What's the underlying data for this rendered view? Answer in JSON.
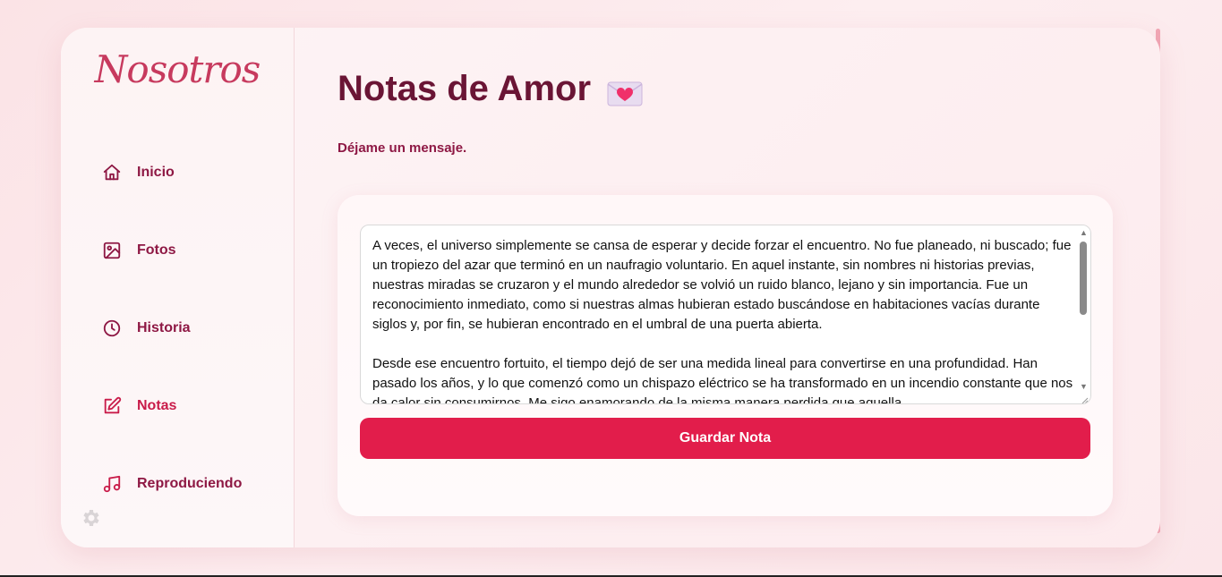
{
  "sidebar": {
    "logo": "Nosotros",
    "items": [
      {
        "label": "Inicio",
        "icon": "home-icon"
      },
      {
        "label": "Fotos",
        "icon": "image-icon"
      },
      {
        "label": "Historia",
        "icon": "clock-icon"
      },
      {
        "label": "Notas",
        "icon": "edit-icon",
        "active": true
      },
      {
        "label": "Reproduciendo",
        "icon": "music-icon"
      }
    ],
    "settings_icon": "gear-icon"
  },
  "main": {
    "title": "Notas de Amor",
    "title_emoji": "love-letter-icon",
    "subtitle": "Déjame un mensaje.",
    "note": {
      "value": "A veces, el universo simplemente se cansa de esperar y decide forzar el encuentro. No fue planeado, ni buscado; fue un tropiezo del azar que terminó en un naufragio voluntario. En aquel instante, sin nombres ni historias previas, nuestras miradas se cruzaron y el mundo alrededor se volvió un ruido blanco, lejano y sin importancia. Fue un reconocimiento inmediato, como si nuestras almas hubieran estado buscándose en habitaciones vacías durante siglos y, por fin, se hubieran encontrado en el umbral de una puerta abierta.\n\nDesde ese encuentro fortuito, el tiempo dejó de ser una medida lineal para convertirse en una profundidad. Han pasado los años, y lo que comenzó como un chispazo eléctrico se ha transformado en un incendio constante que nos da calor sin consumirnos. Me sigo enamorando de la misma manera perdida que aquella"
    },
    "save_label": "Guardar Nota"
  },
  "colors": {
    "accent": "#e21d4b",
    "title": "#6a1535",
    "nav_text": "#8e1844",
    "logo": "#c73a5e"
  }
}
